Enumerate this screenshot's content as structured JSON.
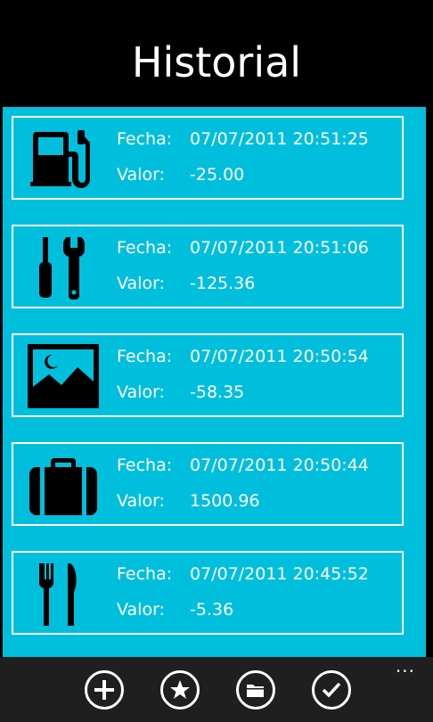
{
  "page": {
    "title": "Historial"
  },
  "labels": {
    "fecha": "Fecha:",
    "valor": "Valor:"
  },
  "entries": [
    {
      "icon": "fuel-pump-icon",
      "fecha": "07/07/2011 20:51:25",
      "valor": "-25.00"
    },
    {
      "icon": "tools-icon",
      "fecha": "07/07/2011 20:51:06",
      "valor": "-125.36"
    },
    {
      "icon": "picture-icon",
      "fecha": "07/07/2011 20:50:54",
      "valor": "-58.35"
    },
    {
      "icon": "briefcase-icon",
      "fecha": "07/07/2011 20:50:44",
      "valor": "1500.96"
    },
    {
      "icon": "fork-knife-icon",
      "fecha": "07/07/2011 20:45:52",
      "valor": "-5.36"
    }
  ],
  "appbar": {
    "buttons": [
      {
        "icon": "add-icon"
      },
      {
        "icon": "star-icon"
      },
      {
        "icon": "folder-icon"
      },
      {
        "icon": "check-icon"
      }
    ],
    "more": "..."
  },
  "colors": {
    "background": "#000000",
    "accent": "#00bfdc",
    "appbar": "#1f1f1f",
    "foreground": "#ffffff"
  }
}
